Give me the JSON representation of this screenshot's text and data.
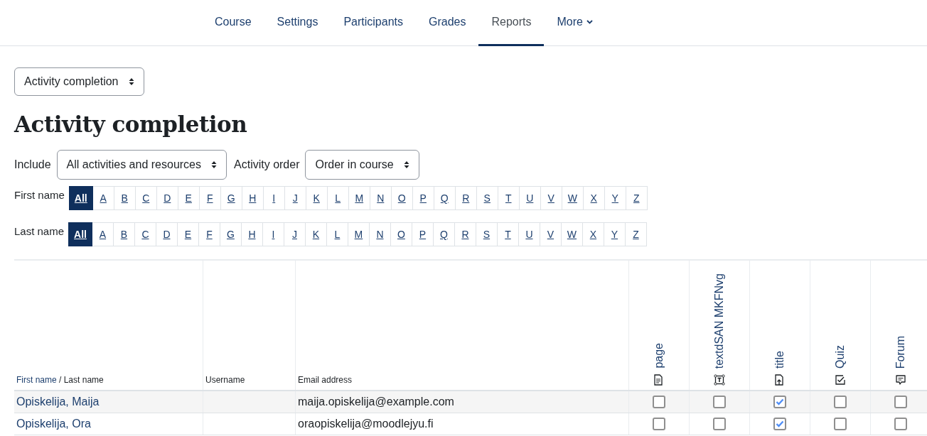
{
  "nav": {
    "tabs": [
      {
        "label": "Course",
        "selected": false
      },
      {
        "label": "Settings",
        "selected": false
      },
      {
        "label": "Participants",
        "selected": false
      },
      {
        "label": "Grades",
        "selected": false
      },
      {
        "label": "Reports",
        "selected": true
      },
      {
        "label": "More",
        "selected": false,
        "dropdown": true
      }
    ]
  },
  "report_select": {
    "value": "Activity completion"
  },
  "heading": "Activity completion",
  "filters": [
    {
      "label": "Include",
      "value": "All activities and resources"
    },
    {
      "label": "Activity order",
      "value": "Order in course"
    }
  ],
  "initials_bars": [
    {
      "label": "First name",
      "letters": [
        {
          "label": "All",
          "selected": true
        },
        {
          "label": "A",
          "selected": false
        },
        {
          "label": "B",
          "selected": false
        },
        {
          "label": "C",
          "selected": false
        },
        {
          "label": "D",
          "selected": false
        },
        {
          "label": "E",
          "selected": false
        },
        {
          "label": "F",
          "selected": false
        },
        {
          "label": "G",
          "selected": false
        },
        {
          "label": "H",
          "selected": false
        },
        {
          "label": "I",
          "selected": false
        },
        {
          "label": "J",
          "selected": false
        },
        {
          "label": "K",
          "selected": false
        },
        {
          "label": "L",
          "selected": false
        },
        {
          "label": "M",
          "selected": false
        },
        {
          "label": "N",
          "selected": false
        },
        {
          "label": "O",
          "selected": false
        },
        {
          "label": "P",
          "selected": false
        },
        {
          "label": "Q",
          "selected": false
        },
        {
          "label": "R",
          "selected": false
        },
        {
          "label": "S",
          "selected": false
        },
        {
          "label": "T",
          "selected": false
        },
        {
          "label": "U",
          "selected": false
        },
        {
          "label": "V",
          "selected": false
        },
        {
          "label": "W",
          "selected": false
        },
        {
          "label": "X",
          "selected": false
        },
        {
          "label": "Y",
          "selected": false
        },
        {
          "label": "Z",
          "selected": false
        }
      ]
    },
    {
      "label": "Last name",
      "letters": [
        {
          "label": "All",
          "selected": true
        },
        {
          "label": "A",
          "selected": false
        },
        {
          "label": "B",
          "selected": false
        },
        {
          "label": "C",
          "selected": false
        },
        {
          "label": "D",
          "selected": false
        },
        {
          "label": "E",
          "selected": false
        },
        {
          "label": "F",
          "selected": false
        },
        {
          "label": "G",
          "selected": false
        },
        {
          "label": "H",
          "selected": false
        },
        {
          "label": "I",
          "selected": false
        },
        {
          "label": "J",
          "selected": false
        },
        {
          "label": "K",
          "selected": false
        },
        {
          "label": "L",
          "selected": false
        },
        {
          "label": "M",
          "selected": false
        },
        {
          "label": "N",
          "selected": false
        },
        {
          "label": "O",
          "selected": false
        },
        {
          "label": "P",
          "selected": false
        },
        {
          "label": "Q",
          "selected": false
        },
        {
          "label": "R",
          "selected": false
        },
        {
          "label": "S",
          "selected": false
        },
        {
          "label": "T",
          "selected": false
        },
        {
          "label": "U",
          "selected": false
        },
        {
          "label": "V",
          "selected": false
        },
        {
          "label": "W",
          "selected": false
        },
        {
          "label": "X",
          "selected": false
        },
        {
          "label": "Y",
          "selected": false
        },
        {
          "label": "Z",
          "selected": false
        }
      ]
    }
  ],
  "table": {
    "name_header": {
      "first": "First name",
      "separator": " / ",
      "last": "Last name"
    },
    "username_header": "Username",
    "email_header": "Email address",
    "activities": [
      {
        "title": "page",
        "kind": "page"
      },
      {
        "title": "textdSAN MKFNvg",
        "kind": "text"
      },
      {
        "title": "title",
        "kind": "file"
      },
      {
        "title": "Quiz",
        "kind": "quiz"
      },
      {
        "title": "Forum",
        "kind": "forum"
      }
    ],
    "rows": [
      {
        "name": "Opiskelija, Maija",
        "email": "maija.opiskelija@example.com",
        "completion": [
          false,
          false,
          true,
          false,
          false
        ]
      },
      {
        "name": "Opiskelija, Ora",
        "email": "oraopiskelija@moodlejyu.fi",
        "completion": [
          false,
          false,
          true,
          false,
          false
        ]
      }
    ]
  }
}
